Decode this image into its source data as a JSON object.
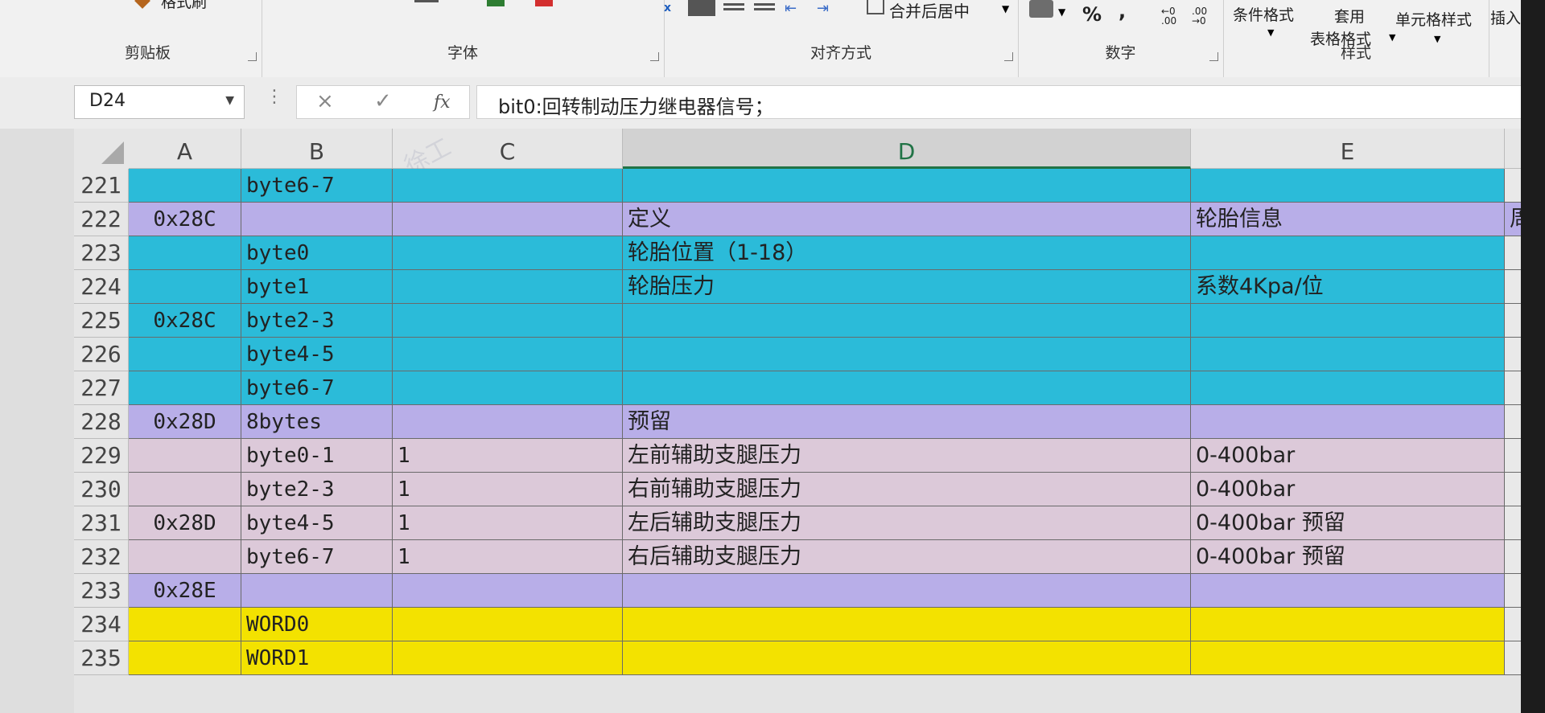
{
  "ribbon": {
    "clipboard": {
      "label": "剪贴板",
      "format_painter": "格式刷"
    },
    "font": {
      "label": "字体"
    },
    "alignment": {
      "label": "对齐方式",
      "merge_center": "合并后居中"
    },
    "number": {
      "label": "数字",
      "percent": "%",
      "comma": ",",
      "inc_decimal": "←0 .00",
      "dec_decimal": ".00 →0"
    },
    "styles": {
      "label": "样式",
      "conditional": "条件格式",
      "table_format_1": "套用",
      "table_format_2": "表格格式",
      "cell_styles": "单元格样式"
    },
    "insert": {
      "label": "插入"
    }
  },
  "formula_bar": {
    "name_box": "D24",
    "cancel": "×",
    "enter": "✓",
    "fx": "fx",
    "content": "bit0:回转制动压力继电器信号；"
  },
  "columns": [
    "A",
    "B",
    "C",
    "D",
    "E"
  ],
  "rows": [
    {
      "num": "221",
      "A": "",
      "B": "byte6-7",
      "C": "",
      "D": "",
      "E": ""
    },
    {
      "num": "222",
      "A": "0x28C",
      "B": "",
      "C": "",
      "D": "定义",
      "E": "轮胎信息",
      "F": "周"
    },
    {
      "num": "223",
      "A": "",
      "B": "byte0",
      "C": "",
      "D": "轮胎位置（1-18）",
      "E": ""
    },
    {
      "num": "224",
      "A": "",
      "B": "byte1",
      "C": "",
      "D": "轮胎压力",
      "E": "系数4Kpa/位"
    },
    {
      "num": "225",
      "A": "0x28C",
      "B": "byte2-3",
      "C": "",
      "D": "",
      "E": ""
    },
    {
      "num": "226",
      "A": "",
      "B": "byte4-5",
      "C": "",
      "D": "",
      "E": ""
    },
    {
      "num": "227",
      "A": "",
      "B": "byte6-7",
      "C": "",
      "D": "",
      "E": ""
    },
    {
      "num": "228",
      "A": "0x28D",
      "B": "8bytes",
      "C": "",
      "D": "预留",
      "E": ""
    },
    {
      "num": "229",
      "A": "",
      "B": "byte0-1",
      "C": "1",
      "D": "左前辅助支腿压力",
      "E": "0-400bar"
    },
    {
      "num": "230",
      "A": "",
      "B": "byte2-3",
      "C": "1",
      "D": "右前辅助支腿压力",
      "E": "0-400bar"
    },
    {
      "num": "231",
      "A": "0x28D",
      "B": "byte4-5",
      "C": "1",
      "D": "左后辅助支腿压力",
      "E": "0-400bar 预留"
    },
    {
      "num": "232",
      "A": "",
      "B": "byte6-7",
      "C": "1",
      "D": "右后辅助支腿压力",
      "E": "0-400bar 预留"
    },
    {
      "num": "233",
      "A": "0x28E",
      "B": "",
      "C": "",
      "D": "",
      "E": ""
    },
    {
      "num": "234",
      "A": "",
      "B": "WORD0",
      "C": "",
      "D": "",
      "E": ""
    },
    {
      "num": "235",
      "A": "",
      "B": "WORD1",
      "C": "",
      "D": "",
      "E": ""
    }
  ],
  "colors": {
    "cyan": "#2bbbd9",
    "lavender": "#b8aee8",
    "pink": "#dcc9d9",
    "yellow": "#f3e200",
    "excel_green": "#217346"
  }
}
